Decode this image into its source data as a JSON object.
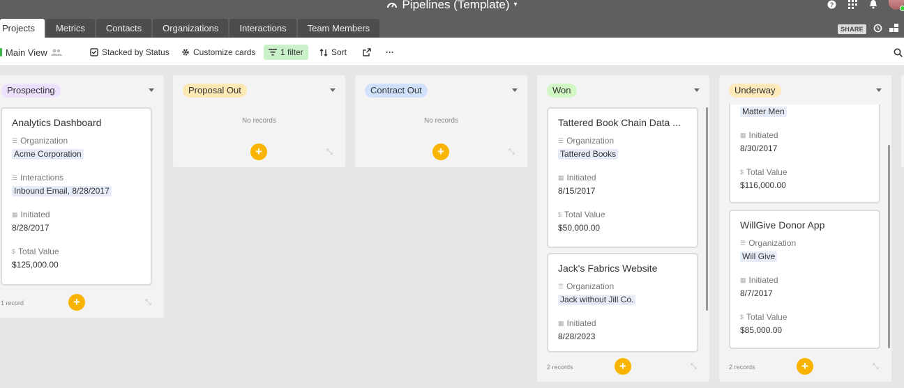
{
  "app": {
    "title": "Pipelines (Template)",
    "title_caret": "▾"
  },
  "top_icons": [
    "help-icon",
    "apps-grid-icon",
    "bell-icon",
    "avatar"
  ],
  "tabs": [
    {
      "label": "Projects",
      "active": true
    },
    {
      "label": "Metrics"
    },
    {
      "label": "Contacts"
    },
    {
      "label": "Organizations"
    },
    {
      "label": "Interactions"
    },
    {
      "label": "Team Members"
    }
  ],
  "share_label": "SHARE",
  "toolbar": {
    "view_name": "Main View",
    "stacked": "Stacked by Status",
    "customize": "Customize cards",
    "filter": "1 filter",
    "sort": "Sort",
    "more": "···"
  },
  "field_labels": {
    "organization": "Organization",
    "interactions": "Interactions",
    "initiated": "Initiated",
    "total_value": "Total Value"
  },
  "columns": [
    {
      "name": "Prospecting",
      "color": "#ede2fe",
      "count": "1 record",
      "cards": [
        {
          "title": "Analytics Dashboard",
          "organization": "Acme Corporation",
          "interactions": "Inbound Email, 8/28/2017",
          "initiated": "8/28/2017",
          "total_value": "$125,000.00"
        }
      ]
    },
    {
      "name": "Proposal Out",
      "color": "#fce8b2",
      "empty": "No records"
    },
    {
      "name": "Contract Out",
      "color": "#d0e1fb",
      "empty": "No records"
    },
    {
      "name": "Won",
      "color": "#d1f7c4",
      "count": "2 records",
      "cards": [
        {
          "title": "Tattered Book Chain Data ...",
          "organization": "Tattered Books",
          "initiated": "8/15/2017",
          "total_value": "$50,000.00"
        },
        {
          "title": "Jack's Fabrics Website",
          "organization": "Jack without Jill Co.",
          "initiated": "8/28/2023"
        }
      ]
    },
    {
      "name": "Underway",
      "color": "#fde9b9",
      "count": "2 records",
      "cards": [
        {
          "organization": "Matter Men",
          "initiated": "8/30/2017",
          "total_value": "$116,000.00"
        },
        {
          "title": "WillGive Donor App",
          "organization": "Will Give",
          "initiated": "8/7/2017",
          "total_value": "$85,000.00"
        }
      ]
    }
  ]
}
